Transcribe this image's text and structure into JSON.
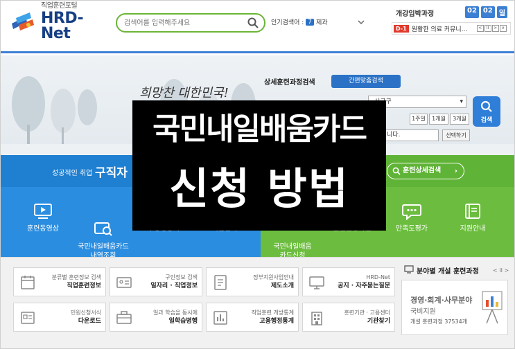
{
  "header": {
    "logo_sub": "직업훈련포털",
    "logo_main": "HRD-Net",
    "search_placeholder": "검색어를 입력해주세요",
    "popular_label": "인기검색어 :",
    "popular_rank": "7",
    "popular_term": "제과",
    "open_title": "개강임박과정",
    "date": [
      "02",
      "02",
      "일"
    ],
    "dday": "D-1",
    "notice_text": "원활한 의료 커뮤니...",
    "notice_ctrls": [
      "<",
      "II",
      ">",
      "∨"
    ]
  },
  "hero": {
    "handwriting": "희망찬 대한민국!",
    "detail_title": "상세훈련과정검색",
    "quick_button": "간편맞춤검색",
    "region": "시군구",
    "periods": [
      "1주일",
      "1개월",
      "3개월"
    ],
    "date_suffix": "니다.",
    "select_button": "선택하기",
    "search_button": "검색"
  },
  "band": {
    "subtitle": "성공적인 취업",
    "main": "구직자",
    "pill_label": "훈련상세검색"
  },
  "menu_left": [
    {
      "label": "훈련동영상"
    },
    {
      "label": "국민내일배움카드\n내역조회"
    },
    {
      "label": "수강생공지"
    },
    {
      "label": "지원안내"
    }
  ],
  "menu_right": [
    {
      "label": "국민내일배움\n카드신청"
    },
    {
      "label": "훈련신청확인"
    },
    {
      "label": "만족도평가"
    },
    {
      "label": "지원안내"
    }
  ],
  "overlay": {
    "line1": "국민내일배움카드",
    "line2": "신청 방법"
  },
  "cards": [
    {
      "small": "분류별 훈련정보 검색",
      "bold": "직업훈련정보"
    },
    {
      "small": "구인정보 검색",
      "bold": "일자리 · 직업정보"
    },
    {
      "small": "정부지원사업안내",
      "bold": "제도소개"
    },
    {
      "small": "HRD-Net",
      "bold": "공지 · 자주묻는질문"
    },
    {
      "small": "민원신청서식",
      "bold": "다운로드"
    },
    {
      "small": "일과 학습을 동시에",
      "bold": "일학습병행"
    },
    {
      "small": "직업훈련 개방통계",
      "bold": "고용행정통계"
    },
    {
      "small": "훈련기관 · 고용센터",
      "bold": "기관찾기"
    }
  ],
  "side": {
    "title": "분야별 개설 훈련과정",
    "ctrl": "< II >",
    "card_title": "경영·회계·사무분야",
    "card_sub": "국비지원",
    "card_count": "개설 훈련과정 37534개"
  },
  "colors": {
    "brand_blue": "#1f7fd0",
    "brand_green": "#5fb336",
    "search_border": "#6bb537",
    "dday_red": "#e03a2d"
  }
}
